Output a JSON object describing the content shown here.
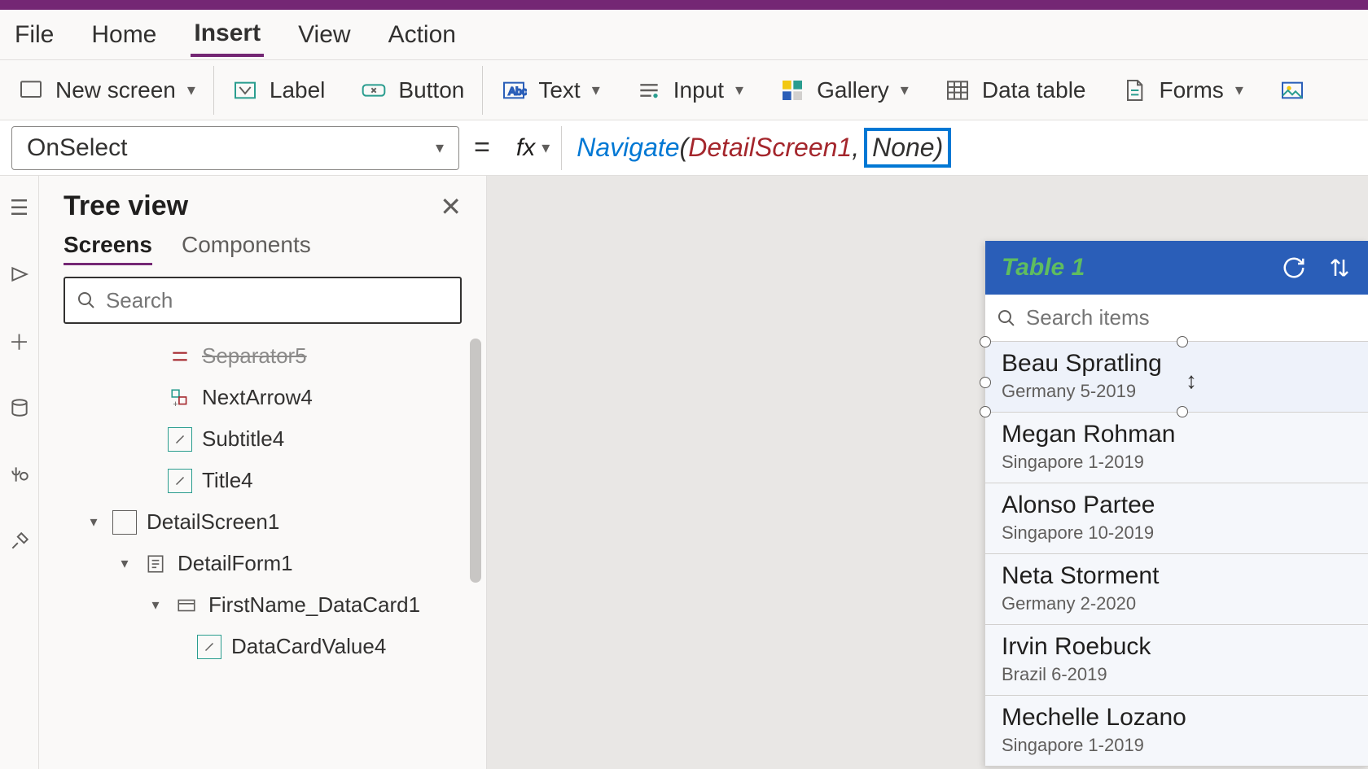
{
  "menu": {
    "items": [
      "File",
      "Home",
      "Insert",
      "View",
      "Action"
    ],
    "active": "Insert"
  },
  "toolbar": {
    "new_screen": "New screen",
    "label": "Label",
    "button": "Button",
    "text": "Text",
    "input": "Input",
    "gallery": "Gallery",
    "datatable": "Data table",
    "forms": "Forms"
  },
  "formula": {
    "property": "OnSelect",
    "fx": "fx",
    "fn": "Navigate",
    "open": "(",
    "arg1": "DetailScreen1",
    "comma": ",",
    "arg2": "None",
    "close": ")"
  },
  "tree": {
    "title": "Tree view",
    "tabs": [
      "Screens",
      "Components"
    ],
    "active_tab": "Screens",
    "search_placeholder": "Search",
    "nodes": {
      "separator5": "Separator5",
      "nextarrow4": "NextArrow4",
      "subtitle4": "Subtitle4",
      "title4": "Title4",
      "detailscreen1": "DetailScreen1",
      "detailform1": "DetailForm1",
      "firstname_datacard1": "FirstName_DataCard1",
      "datacardvalue4": "DataCardValue4"
    }
  },
  "preview": {
    "title": "Table 1",
    "search_placeholder": "Search items",
    "items": [
      {
        "title": "Beau Spratling",
        "sub": "Germany 5-2019"
      },
      {
        "title": "Megan Rohman",
        "sub": "Singapore 1-2019"
      },
      {
        "title": "Alonso Partee",
        "sub": "Singapore 10-2019"
      },
      {
        "title": "Neta Storment",
        "sub": "Germany 2-2020"
      },
      {
        "title": "Irvin Roebuck",
        "sub": "Brazil 6-2019"
      },
      {
        "title": "Mechelle Lozano",
        "sub": "Singapore 1-2019"
      }
    ]
  }
}
